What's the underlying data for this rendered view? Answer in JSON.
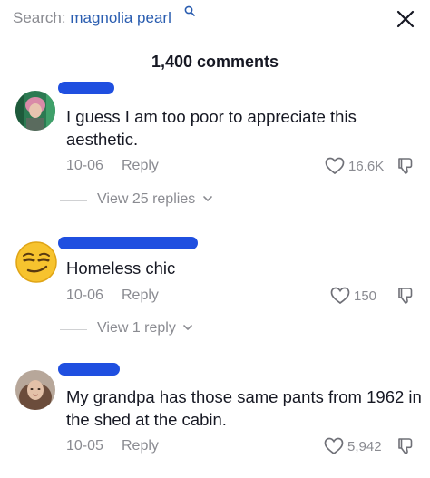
{
  "search": {
    "label": "Search:",
    "term": "magnolia pearl"
  },
  "header": {
    "comments_count": "1,400 comments"
  },
  "colors": {
    "accent": "#2a5db0",
    "redaction": "#1f4fe0",
    "muted": "#8a8b91"
  },
  "comments": [
    {
      "text": "I guess I am too poor to appreciate this aesthetic.",
      "date": "10-06",
      "reply_label": "Reply",
      "likes": "16.6K",
      "replies_label": "View 25 replies",
      "avatar_icon": "user-avatar-photo"
    },
    {
      "text": "Homeless chic",
      "date": "10-06",
      "reply_label": "Reply",
      "likes": "150",
      "replies_label": "View 1 reply",
      "avatar_icon": "smirk-emoji-avatar"
    },
    {
      "text": "My grandpa has those same pants from 1962 in the shed at the cabin.",
      "date": "10-05",
      "reply_label": "Reply",
      "likes": "5,942",
      "avatar_icon": "user-avatar-photo"
    }
  ]
}
